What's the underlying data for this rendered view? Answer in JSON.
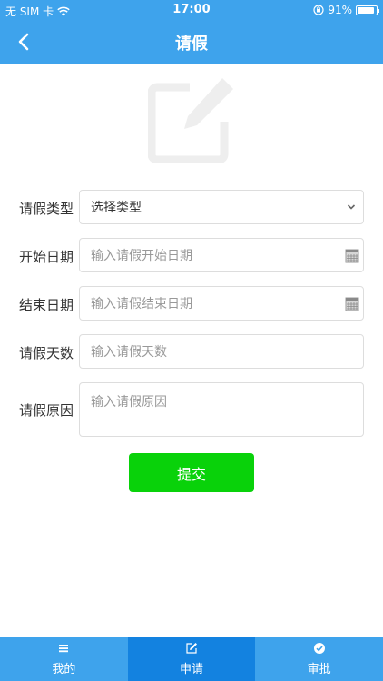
{
  "status_bar": {
    "carrier": "无 SIM 卡",
    "time": "17:00",
    "battery": "91%",
    "battery_level": 0.91
  },
  "nav": {
    "title": "请假",
    "back_icon": "chevron-left-icon"
  },
  "hero": {
    "icon": "edit-icon"
  },
  "form": {
    "type": {
      "label": "请假类型",
      "value": "选择类型"
    },
    "start_date": {
      "label": "开始日期",
      "placeholder": "输入请假开始日期"
    },
    "end_date": {
      "label": "结束日期",
      "placeholder": "输入请假结束日期"
    },
    "days": {
      "label": "请假天数",
      "placeholder": "输入请假天数"
    },
    "reason": {
      "label": "请假原因",
      "placeholder": "输入请假原因"
    },
    "submit_label": "提交"
  },
  "tabbar": {
    "items": [
      {
        "label": "我的",
        "icon": "menu-icon",
        "active": false
      },
      {
        "label": "申请",
        "icon": "edit-icon",
        "active": true
      },
      {
        "label": "审批",
        "icon": "check-circle-icon",
        "active": false
      }
    ]
  },
  "colors": {
    "primary": "#3ea3ec",
    "tab_active": "#1382e0",
    "submit": "#09d20a",
    "placeholder": "#999999"
  }
}
